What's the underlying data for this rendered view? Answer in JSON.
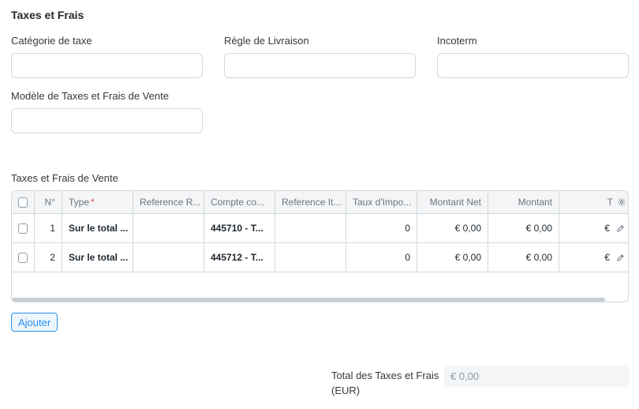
{
  "section": {
    "title": "Taxes et Frais"
  },
  "fields": {
    "tax_category": {
      "label": "Catégorie de taxe",
      "value": ""
    },
    "shipping_rule": {
      "label": "Règle de Livraison",
      "value": ""
    },
    "incoterm": {
      "label": "Incoterm",
      "value": ""
    },
    "tax_template": {
      "label": "Modèle de Taxes et Frais de Vente",
      "value": ""
    }
  },
  "grid": {
    "label": "Taxes et Frais de Vente",
    "columns": {
      "no": "N°",
      "type": "Type",
      "type_required": "*",
      "reference_row": "Reference R...",
      "account": "Compte co...",
      "reference_item": "Reference It...",
      "tax_rate": "Taux d'Impo...",
      "net_amount": "Montant Net",
      "amount": "Montant",
      "total": "T"
    },
    "rows": [
      {
        "no": "1",
        "type": "Sur le total ...",
        "reference_row": "",
        "account": "445710 - T...",
        "reference_item": "",
        "tax_rate": "0",
        "net_amount": "€ 0,00",
        "amount": "€ 0,00",
        "total": "€"
      },
      {
        "no": "2",
        "type": "Sur le total ...",
        "reference_row": "",
        "account": "445712 - T...",
        "reference_item": "",
        "tax_rate": "0",
        "net_amount": "€ 0,00",
        "amount": "€ 0,00",
        "total": "€"
      }
    ],
    "add_button": "Ajouter"
  },
  "totals": {
    "label": "Total des Taxes et Frais (EUR)",
    "value": "€ 0,00"
  },
  "icons": {
    "settings": "gear-icon",
    "edit": "pencil-icon"
  },
  "colors": {
    "accent": "#2490ef",
    "required": "#e24c4c",
    "border": "#d1d8dd"
  }
}
